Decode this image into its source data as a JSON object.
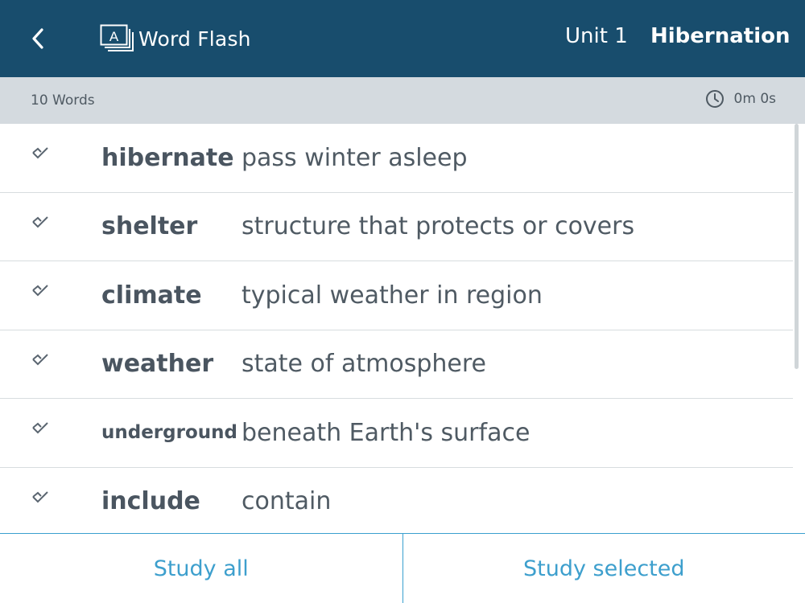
{
  "header": {
    "app_title": "Word Flash",
    "app_icon_letter": "A",
    "unit": "Unit 1",
    "lesson": "Hibernation",
    "color": "#184d6d"
  },
  "subbar": {
    "word_count": "10 Words",
    "timer": "0m 0s"
  },
  "words": [
    {
      "term": "hibernate",
      "definition": "pass winter asleep",
      "checked": true
    },
    {
      "term": "shelter",
      "definition": "structure that protects or covers",
      "checked": true
    },
    {
      "term": "climate",
      "definition": "typical weather in region",
      "checked": true
    },
    {
      "term": "weather",
      "definition": "state of atmosphere",
      "checked": true
    },
    {
      "term": "underground",
      "definition": "beneath Earth's surface",
      "checked": true
    },
    {
      "term": "include",
      "definition": "contain",
      "checked": true
    }
  ],
  "footer": {
    "study_all": "Study all",
    "study_selected": "Study selected",
    "accent": "#3d9fcd"
  },
  "icons": {
    "back": "chevron-left-icon",
    "logo": "flashcard-icon",
    "timer": "clock-icon",
    "row": "checkmark-icon"
  }
}
